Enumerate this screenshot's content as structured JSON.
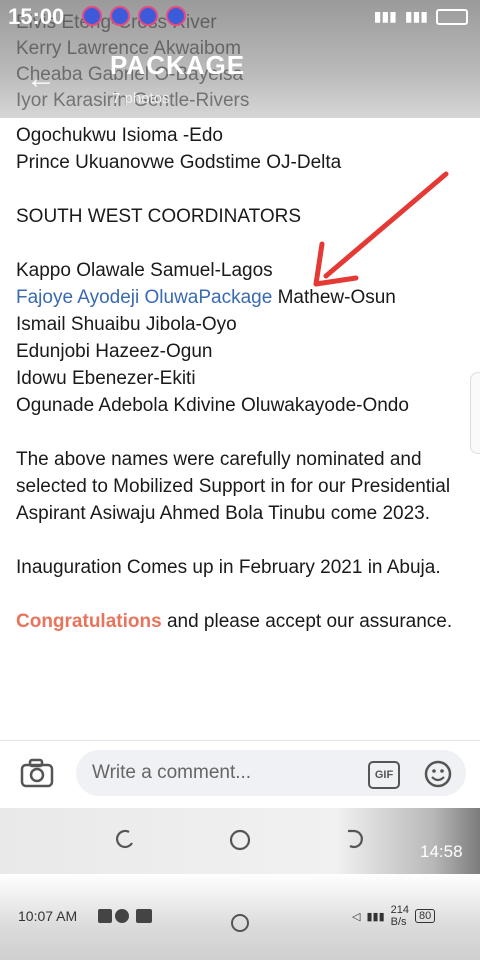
{
  "status_bar": {
    "time": "15:00"
  },
  "header": {
    "title": "PACKAGE",
    "subtitle": "7 photos",
    "faded_lines": [
      "Elvis Eteng-Cross River",
      "Kerry Lawrence Akwaibom",
      "Cheaba Gabriel O-Bayelsa",
      "Iyor Karasirin Gentle-Rivers"
    ]
  },
  "post": {
    "top_lines": [
      "Ogochukwu Isioma -Edo",
      "Prince Ukuanovwe Godstime OJ-Delta"
    ],
    "section_heading": "SOUTH WEST COORDINATORS",
    "coord_1": "Kappo Olawale Samuel-Lagos",
    "coord_2_link": "Fajoye Ayodeji OluwaPackage",
    "coord_2_rest": " Mathew-Osun",
    "coord_3": "Ismail Shuaibu Jibola-Oyo",
    "coord_4": "Edunjobi Hazeez-Ogun",
    "coord_5": "Idowu Ebenezer-Ekiti",
    "coord_6": "Ogunade Adebola Kdivine Oluwakayode-Ondo",
    "para_1": "The above names were carefully nominated and selected to Mobilized Support in for our Presidential Aspirant Asiwaju Ahmed Bola Tinubu come 2023.",
    "para_2": "Inauguration Comes up in February 2021 in Abuja.",
    "congrats_word": "Congratulations",
    "congrats_rest": " and please accept our assurance."
  },
  "comment_bar": {
    "placeholder": "Write a comment...",
    "gif_label": "GIF"
  },
  "nav_bar": {
    "time": "14:58"
  },
  "bottom_bar": {
    "time": "10:07 AM",
    "speed": "214",
    "speed_unit": "B/s",
    "battery": "80"
  },
  "colors": {
    "link": "#3a6ab0",
    "congrats": "#e8745c",
    "annotation_arrow": "#e53935"
  }
}
